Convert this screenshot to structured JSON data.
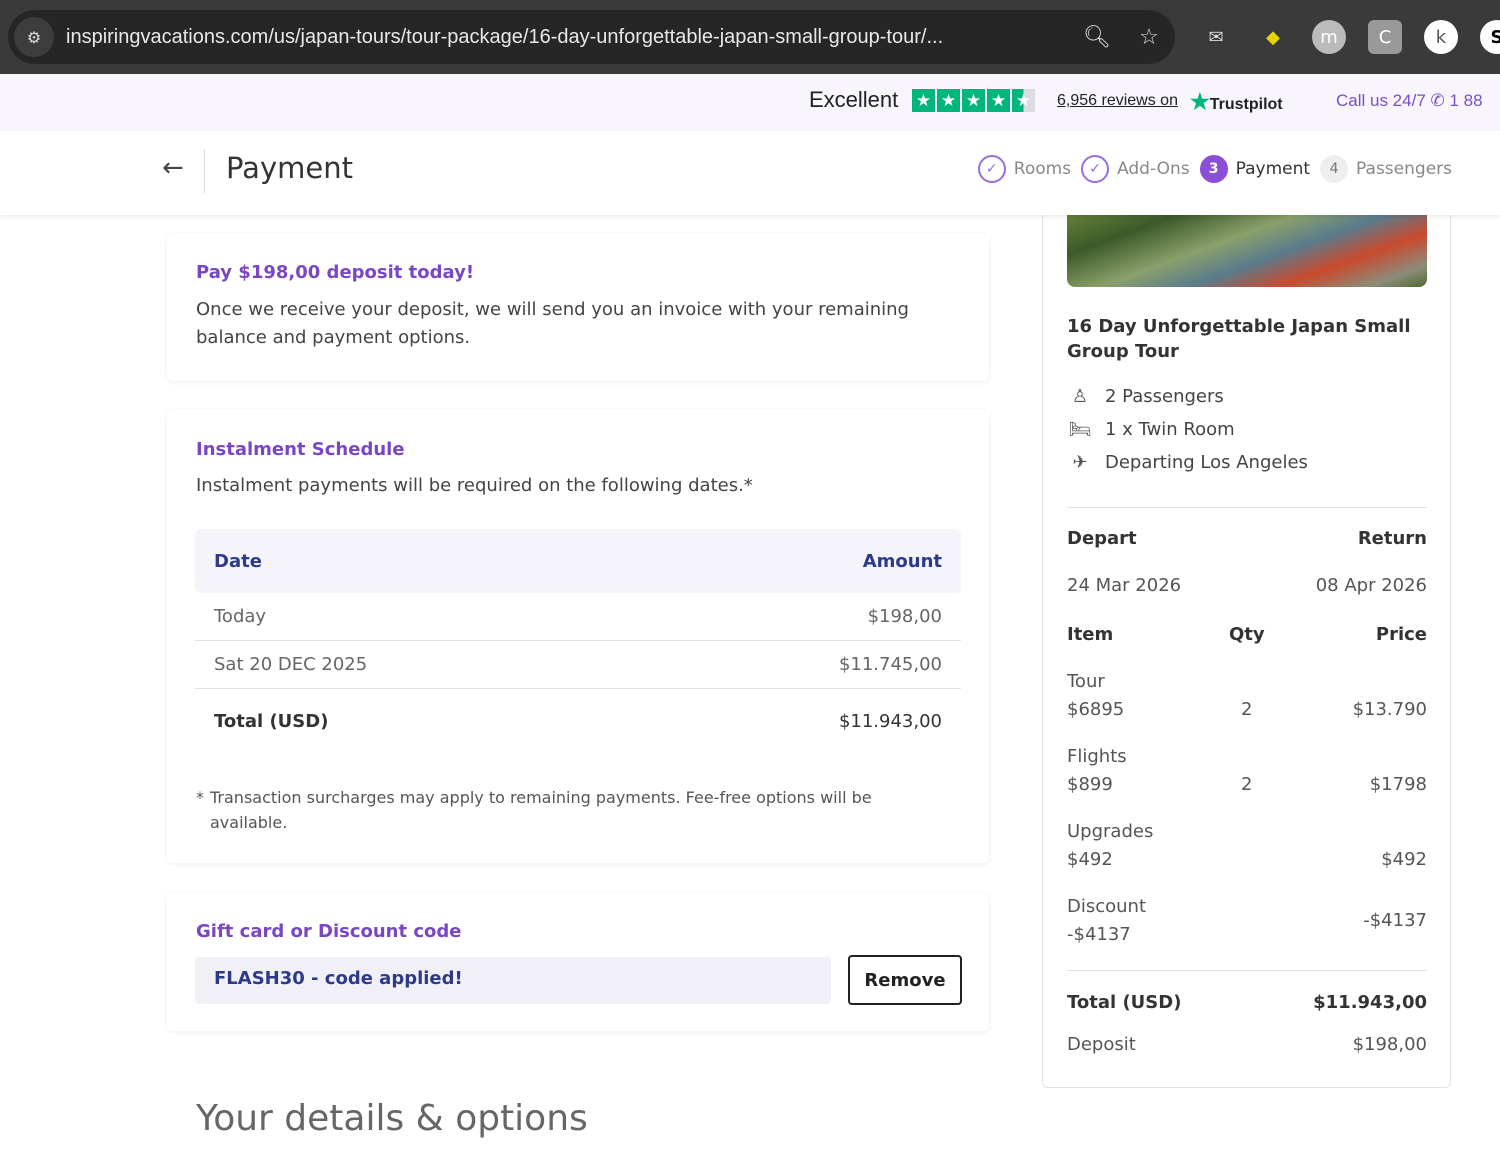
{
  "browser": {
    "url": "inspiringvacations.com/us/japan-tours/tour-package/16-day-unforgettable-japan-small-group-tour/..."
  },
  "trustpilot": {
    "rating_label": "Excellent",
    "stars": 4.5,
    "reviews": "6,956 reviews on",
    "brand": "Trustpilot",
    "call": "Call us 24/7",
    "phone": "1 88"
  },
  "header": {
    "title": "Payment",
    "steps": [
      {
        "num": "✓",
        "label": "Rooms"
      },
      {
        "num": "✓",
        "label": "Add-Ons"
      },
      {
        "num": "3",
        "label": "Payment"
      },
      {
        "num": "4",
        "label": "Passengers"
      }
    ]
  },
  "deposit": {
    "title": "Pay $198,00 deposit today!",
    "text": "Once we receive your deposit, we will send you an invoice with your remaining balance and payment options."
  },
  "instalments": {
    "title": "Instalment Schedule",
    "text": "Instalment payments will be required on the following dates.*",
    "col_date": "Date",
    "col_amount": "Amount",
    "rows": [
      {
        "date": "Today",
        "amount": "$198,00"
      },
      {
        "date": "Sat 20 DEC 2025",
        "amount": "$11.745,00"
      }
    ],
    "total_label": "Total (USD)",
    "total": "$11.943,00",
    "note": "Transaction surcharges may apply to remaining payments. Fee-free options will be available."
  },
  "discount": {
    "title": "Gift card or Discount code",
    "code": "FLASH30 - code applied!",
    "remove": "Remove"
  },
  "details_heading": "Your details & options",
  "summary": {
    "title": "16 Day Unforgettable Japan Small Group Tour",
    "passengers": "2 Passengers",
    "room": "1 x Twin Room",
    "departing": "Departing Los Angeles",
    "depart_label": "Depart",
    "return_label": "Return",
    "depart_date": "24 Mar 2026",
    "return_date": "08 Apr 2026",
    "col_item": "Item",
    "col_qty": "Qty",
    "col_price": "Price",
    "items": [
      {
        "name": "Tour",
        "unit": "$6895",
        "qty": "2",
        "price": "$13.790"
      },
      {
        "name": "Flights",
        "unit": "$899",
        "qty": "2",
        "price": "$1798"
      },
      {
        "name": "Upgrades",
        "unit": "$492",
        "qty": "",
        "price": "$492"
      }
    ],
    "discount": {
      "name": "Discount",
      "unit": "-$4137",
      "price": "-$4137"
    },
    "total_label": "Total (USD)",
    "total": "$11.943,00",
    "deposit_label": "Deposit",
    "deposit": "$198,00"
  }
}
